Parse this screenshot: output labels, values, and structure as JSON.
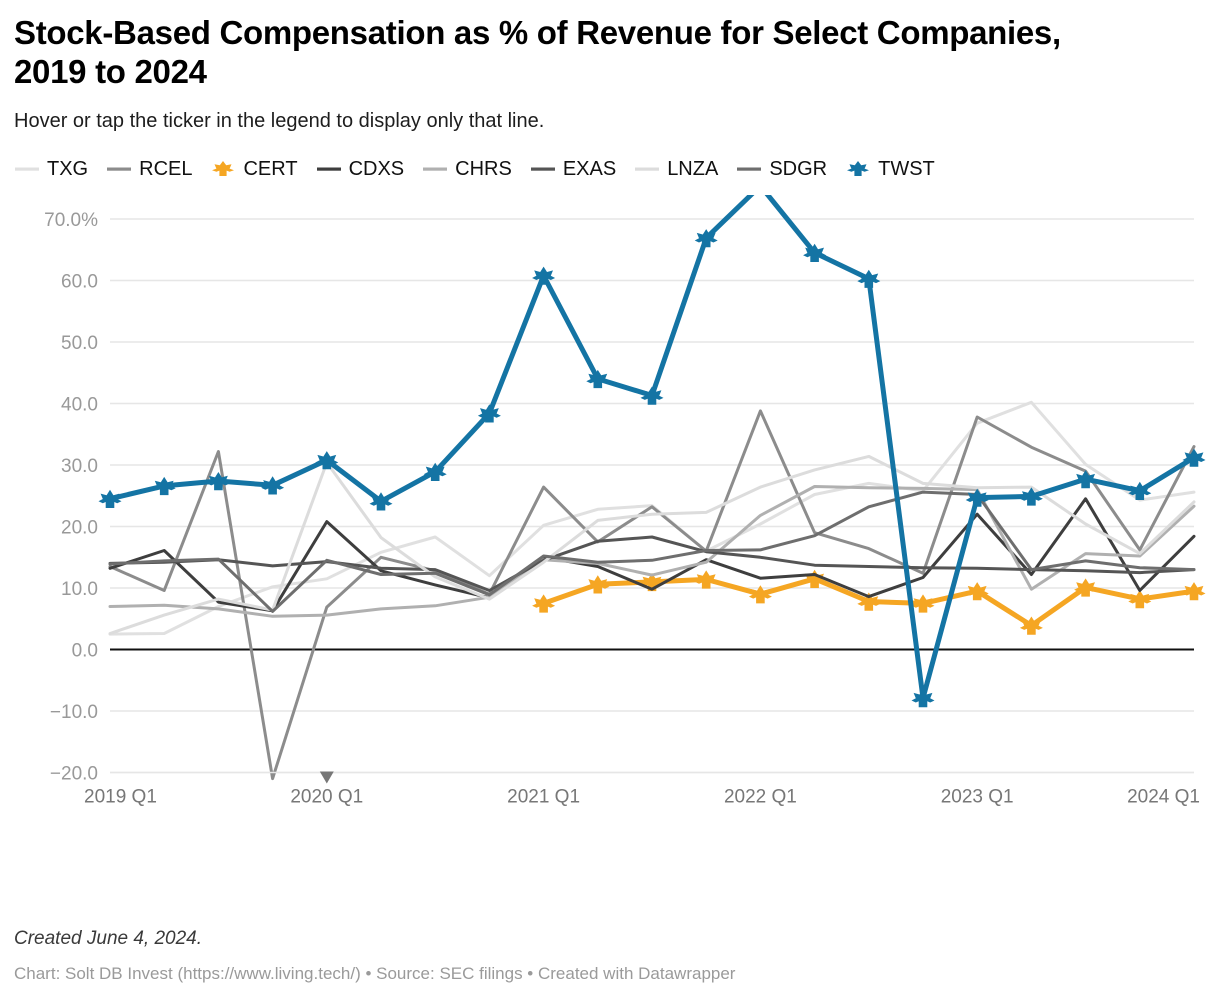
{
  "header": {
    "title": "Stock-Based Compensation as % of Revenue for Select Companies, 2019 to 2024",
    "subtitle": "Hover or tap the ticker in the legend to display only that line."
  },
  "footer": {
    "created": "Created June 4, 2024.",
    "credit": "Chart: Solt DB Invest (https://www.living.tech/) • Source: SEC filings • Created with Datawrapper"
  },
  "chart_data": {
    "type": "line",
    "title": "Stock-Based Compensation as % of Revenue for Select Companies, 2019 to 2024",
    "subtitle": "Hover or tap the ticker in the legend to display only that line.",
    "xlabel": "",
    "ylabel": "",
    "ylim": [
      -22,
      78
    ],
    "xlim": [
      0,
      20
    ],
    "grid": true,
    "legend_position": "top",
    "zero_line": true,
    "x": [
      "2019 Q1",
      "2019 Q2",
      "2019 Q3",
      "2019 Q4",
      "2020 Q1",
      "2020 Q2",
      "2020 Q3",
      "2020 Q4",
      "2021 Q1",
      "2021 Q2",
      "2021 Q3",
      "2021 Q4",
      "2022 Q1",
      "2022 Q2",
      "2022 Q3",
      "2022 Q4",
      "2023 Q1",
      "2023 Q2",
      "2023 Q3",
      "2023 Q4",
      "2024 Q1"
    ],
    "x_tick_labels": [
      "2019 Q1",
      "2020 Q1",
      "2021 Q1",
      "2022 Q1",
      "2023 Q1",
      "2024 Q1"
    ],
    "x_tick_indices": [
      0,
      4,
      8,
      12,
      16,
      20
    ],
    "y_ticks": [
      -20,
      -10,
      0,
      10,
      20,
      30,
      40,
      50,
      60,
      70
    ],
    "y_tick_labels": [
      "−20.0",
      "−10.0",
      "0.0",
      "10.0",
      "20.0",
      "30.0",
      "40.0",
      "50.0",
      "60.0",
      "70.0%"
    ],
    "series": [
      {
        "name": "TXG",
        "color": "#e0e0e0",
        "width": 3,
        "marker": false,
        "values": [
          2.5,
          2.6,
          7.0,
          10.2,
          11.5,
          15.8,
          18.3,
          12.0,
          20.2,
          22.8,
          23.4,
          16.0,
          20.4,
          25.2,
          27.0,
          25.8,
          36.8,
          40.2,
          30.1,
          24.3,
          25.6
        ]
      },
      {
        "name": "RCEL",
        "color": "#8c8c8c",
        "width": 3,
        "marker": false,
        "values": [
          13.5,
          9.6,
          32.2,
          -21.0,
          6.9,
          15.0,
          12.8,
          9.0,
          26.4,
          17.5,
          23.2,
          16.0,
          38.8,
          19.0,
          16.4,
          12.4,
          37.8,
          32.9,
          29.0,
          16.2,
          33.0
        ]
      },
      {
        "name": "CERT",
        "color": "#f5a623",
        "width": 5,
        "marker": true,
        "values": [
          null,
          null,
          null,
          null,
          null,
          null,
          null,
          null,
          7.5,
          10.6,
          11.0,
          11.4,
          9.0,
          11.5,
          7.8,
          7.5,
          9.5,
          3.9,
          10.1,
          8.2,
          9.5
        ]
      },
      {
        "name": "CDXS",
        "color": "#3e3e3e",
        "width": 3,
        "marker": false,
        "values": [
          13.2,
          16.1,
          7.7,
          6.3,
          20.8,
          12.8,
          10.5,
          8.4,
          15.0,
          13.5,
          9.8,
          14.6,
          11.6,
          12.2,
          8.6,
          11.7,
          22.0,
          12.2,
          24.5,
          9.6,
          18.4
        ]
      },
      {
        "name": "CHRS",
        "color": "#b0b0b0",
        "width": 3,
        "marker": false,
        "values": [
          7.0,
          7.2,
          6.6,
          5.4,
          5.6,
          6.6,
          7.1,
          8.5,
          14.6,
          14.0,
          12.1,
          14.2,
          21.8,
          26.5,
          26.3,
          26.2,
          26.0,
          9.8,
          15.6,
          15.2,
          23.3
        ]
      },
      {
        "name": "EXAS",
        "color": "#555555",
        "width": 3,
        "marker": false,
        "values": [
          14.0,
          14.2,
          14.6,
          13.6,
          14.3,
          13.2,
          13.0,
          9.6,
          14.5,
          17.6,
          18.3,
          15.9,
          15.0,
          13.7,
          13.5,
          13.3,
          13.2,
          13.0,
          12.8,
          12.5,
          13.0
        ]
      },
      {
        "name": "LNZA",
        "color": "#dcdcdc",
        "width": 3,
        "marker": false,
        "values": [
          2.6,
          5.6,
          8.2,
          6.4,
          30.4,
          18.2,
          11.8,
          8.2,
          14.2,
          21.0,
          22.0,
          22.3,
          26.4,
          29.2,
          31.4,
          27.0,
          26.3,
          26.4,
          20.4,
          15.6,
          24.0
        ]
      },
      {
        "name": "SDGR",
        "color": "#6e6e6e",
        "width": 3,
        "marker": false,
        "values": [
          13.9,
          14.4,
          14.7,
          6.2,
          14.5,
          12.2,
          12.4,
          8.9,
          15.2,
          14.2,
          14.5,
          16.1,
          16.2,
          18.5,
          23.2,
          25.6,
          25.2,
          13.0,
          14.4,
          13.3,
          13.0
        ]
      },
      {
        "name": "TWST",
        "color": "#1474a4",
        "width": 5,
        "marker": true,
        "values": [
          24.5,
          26.6,
          27.4,
          26.7,
          30.8,
          24.1,
          28.9,
          38.4,
          60.8,
          44.0,
          41.3,
          66.9,
          75.4,
          64.5,
          60.3,
          -7.9,
          24.7,
          24.9,
          27.7,
          25.8,
          31.2
        ]
      }
    ]
  }
}
